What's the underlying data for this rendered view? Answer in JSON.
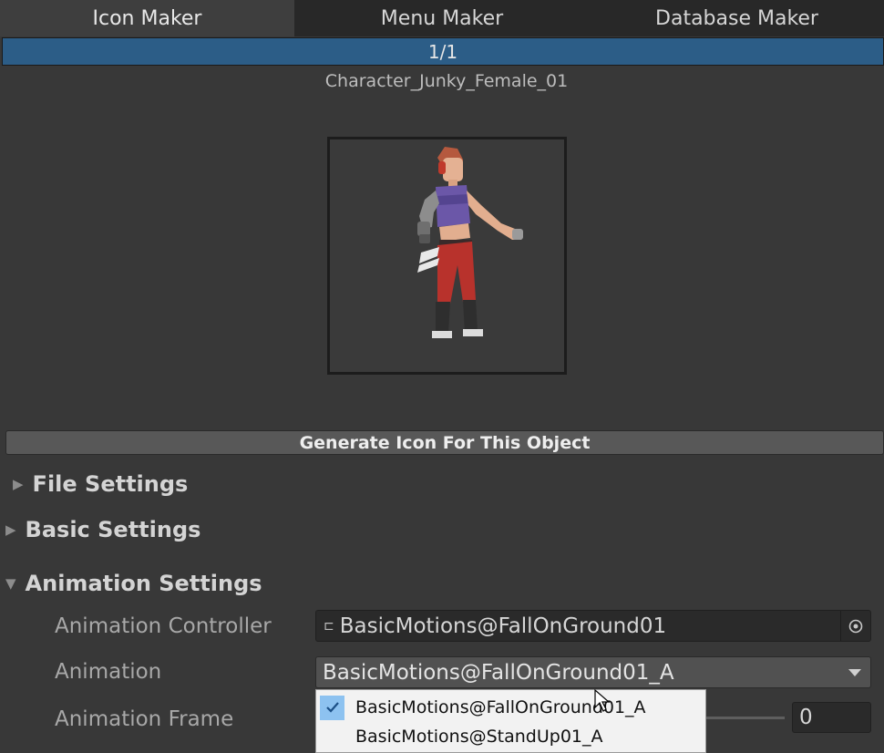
{
  "tabs": [
    {
      "label": "Icon Maker",
      "active": true
    },
    {
      "label": "Menu Maker",
      "active": false
    },
    {
      "label": "Database Maker",
      "active": false
    }
  ],
  "pager": {
    "label": "1/1"
  },
  "object_name": "Character_Junky_Female_01",
  "generate_button": {
    "label": "Generate Icon For This Object"
  },
  "sections": {
    "file_settings": {
      "label": "File Settings",
      "expanded": false
    },
    "basic_settings": {
      "label": "Basic Settings",
      "expanded": false
    },
    "animation_settings": {
      "label": "Animation Settings",
      "expanded": true
    }
  },
  "animation": {
    "controller_label": "Animation Controller",
    "controller_value": "BasicMotions@FallOnGround01",
    "animation_label": "Animation",
    "animation_value": "BasicMotions@FallOnGround01_A",
    "frame_label": "Animation Frame",
    "frame_value": "0"
  },
  "animation_dropdown_options": [
    {
      "label": "BasicMotions@FallOnGround01_A",
      "selected": true
    },
    {
      "label": "BasicMotions@StandUp01_A",
      "selected": false
    }
  ],
  "colors": {
    "background": "#383838",
    "pager_blue": "#2c5d87",
    "popup_check": "#8dc2f0"
  },
  "icons": {
    "collapsed_arrow": "triangle-right-icon",
    "expanded_arrow": "triangle-down-icon",
    "controller_asset": "animator-controller-icon",
    "object_picker": "object-picker-icon",
    "dropdown_caret": "caret-down-icon",
    "check": "checkmark-icon",
    "cursor": "mouse-pointer-icon"
  }
}
